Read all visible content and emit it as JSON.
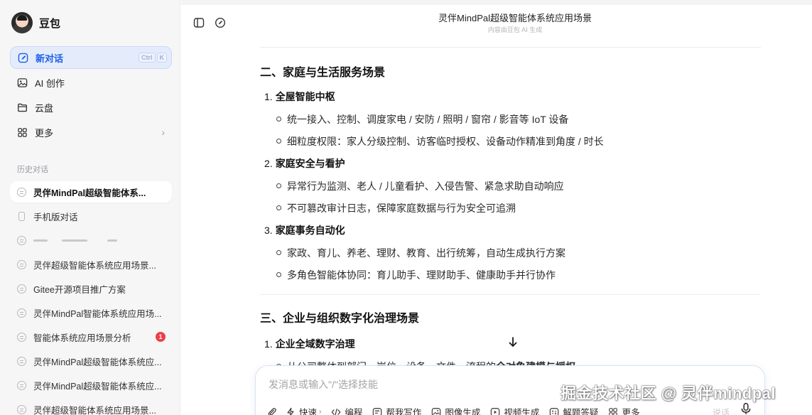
{
  "sidebar": {
    "brand": "豆包",
    "nav": [
      {
        "label": "新对话",
        "icon": "edit-icon",
        "shortcut": [
          "Ctrl",
          "K"
        ]
      },
      {
        "label": "AI 创作",
        "icon": "image-icon"
      },
      {
        "label": "云盘",
        "icon": "folder-icon"
      },
      {
        "label": "更多",
        "icon": "grid-icon"
      }
    ],
    "history_title": "历史对话",
    "history": [
      {
        "label": "灵伴MindPal超级智能体系...",
        "current": true
      },
      {
        "label": "手机版对话",
        "icon": "phone-icon"
      },
      {
        "label": "",
        "redacted": true
      },
      {
        "label": "灵伴超级智能体系统应用场景..."
      },
      {
        "label": "Gitee开源项目推广方案"
      },
      {
        "label": "灵伴MindPal智能体系统应用场..."
      },
      {
        "label": "智能体系统应用场景分析",
        "badge": "1"
      },
      {
        "label": "灵伴MindPal超级智能体系统应..."
      },
      {
        "label": "灵伴MindPal超级智能体系统应..."
      },
      {
        "label": "灵伴超级智能体系统应用场景..."
      }
    ]
  },
  "header": {
    "title": "灵伴MindPal超级智能体系统应用场景",
    "subtitle": "内容由豆包 AI 生成"
  },
  "article": {
    "sections": [
      {
        "heading": "二、家庭与生活服务场景",
        "items": [
          {
            "num": "1.",
            "title": "全屋智能中枢",
            "bullets": [
              "统一接入、控制、调度家电 / 安防 / 照明 / 窗帘 / 影音等 IoT 设备",
              "细粒度权限：家人分级控制、访客临时授权、设备动作精准到角度 / 时长"
            ]
          },
          {
            "num": "2.",
            "title": "家庭安全与看护",
            "bullets": [
              "异常行为监测、老人 / 儿童看护、入侵告警、紧急求助自动响应",
              "不可篡改审计日志，保障家庭数据与行为安全可追溯"
            ]
          },
          {
            "num": "3.",
            "title": "家庭事务自动化",
            "bullets": [
              "家政、育儿、养老、理财、教育、出行统筹，自动生成执行方案",
              "多角色智能体协同：育儿助手、理财助手、健康助手并行协作"
            ]
          }
        ]
      },
      {
        "heading": "三、企业与组织数字化治理场景",
        "items": [
          {
            "num": "1.",
            "title": "企业全域数字治理",
            "bullets": [
              {
                "text": "从公司整体到部门、岗位、设备、文件、流程的",
                "bold": "全对象建模与授权"
              }
            ]
          }
        ]
      }
    ]
  },
  "composer": {
    "placeholder": "发消息或输入\"/\"选择技能",
    "skills": [
      {
        "label": "快速",
        "icon": "bolt-icon",
        "dropdown": true
      },
      {
        "label": "编程",
        "icon": "code-icon"
      },
      {
        "label": "帮我写作",
        "icon": "write-icon"
      },
      {
        "label": "图像生成",
        "icon": "image-gen-icon"
      },
      {
        "label": "视频生成",
        "icon": "video-icon"
      },
      {
        "label": "解题答疑",
        "icon": "solve-icon"
      },
      {
        "label": "更多",
        "icon": "grid-icon"
      }
    ],
    "faint_hint": "说话..."
  },
  "watermark": "掘金技术社区 @ 灵伴mindpal",
  "colors": {
    "accent": "#1d5fe6",
    "active_bg": "#e4ecfc",
    "sidebar_bg": "#f6f6f7",
    "badge": "#ee3f46"
  }
}
